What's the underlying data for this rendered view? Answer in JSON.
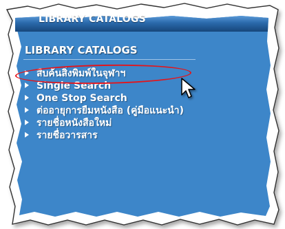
{
  "window": {
    "header_title": "LIBRARY CATALOGS",
    "section_title": "LIBRARY CATALOGS"
  },
  "menu": {
    "items": [
      {
        "label": "สืบค้นสิ่งพิมพ์ในจุฬาฯ",
        "highlighted": true
      },
      {
        "label": "Single Search"
      },
      {
        "label": "One Stop Search"
      },
      {
        "label": "ต่ออายุการยืมหนังสือ (คู่มือแนะนำ)"
      },
      {
        "label": "รายชื่อหนังสือใหม่"
      },
      {
        "label": "รายชื่อวารสาร"
      }
    ]
  },
  "colors": {
    "panel_blue": "#3d86c9",
    "header_dark": "#1d4f83",
    "text": "#ffffff",
    "highlight": "#e3151b"
  },
  "icons": {
    "bullet": "triangle-right-icon",
    "cursor": "mouse-pointer-icon"
  }
}
